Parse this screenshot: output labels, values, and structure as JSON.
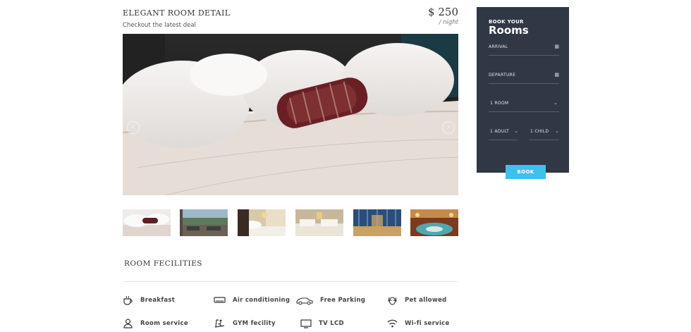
{
  "room": {
    "title": "ELEGANT ROOM DETAIL",
    "subtitle": "Checkout the latest deal",
    "price": "$ 250",
    "per": "/ night"
  },
  "gallery": {
    "prev_icon": "chevron-left-icon",
    "next_icon": "chevron-right-icon",
    "thumbnails": [
      "bed-with-pillow",
      "outdoor-lounge",
      "bedroom-lamp",
      "twin-bedroom",
      "hotel-atrium",
      "lobby-fountain"
    ]
  },
  "facilities": {
    "title": "ROOM FECILITIES",
    "items": [
      {
        "label": "Breakfast",
        "icon": "coffee-cup-icon"
      },
      {
        "label": "Air conditioning",
        "icon": "air-conditioner-icon"
      },
      {
        "label": "Free Parking",
        "icon": "car-icon"
      },
      {
        "label": "Pet allowed",
        "icon": "dog-icon"
      },
      {
        "label": "Room service",
        "icon": "person-icon"
      },
      {
        "label": "GYM fecility",
        "icon": "treadmill-icon"
      },
      {
        "label": "TV LCD",
        "icon": "tv-icon"
      },
      {
        "label": "Wi-fi service",
        "icon": "wifi-icon"
      }
    ]
  },
  "booking": {
    "title_small": "BOOK YOUR",
    "title_big": "Rooms",
    "arrival": "ARRIVAL",
    "departure": "DEPARTURE",
    "rooms": "1 ROOM",
    "adults": "1 ADULT",
    "children": "1 CHILD",
    "book": "BOOK",
    "calendar_icon": "calendar-icon",
    "dropdown_icon": "chevron-down-icon"
  }
}
